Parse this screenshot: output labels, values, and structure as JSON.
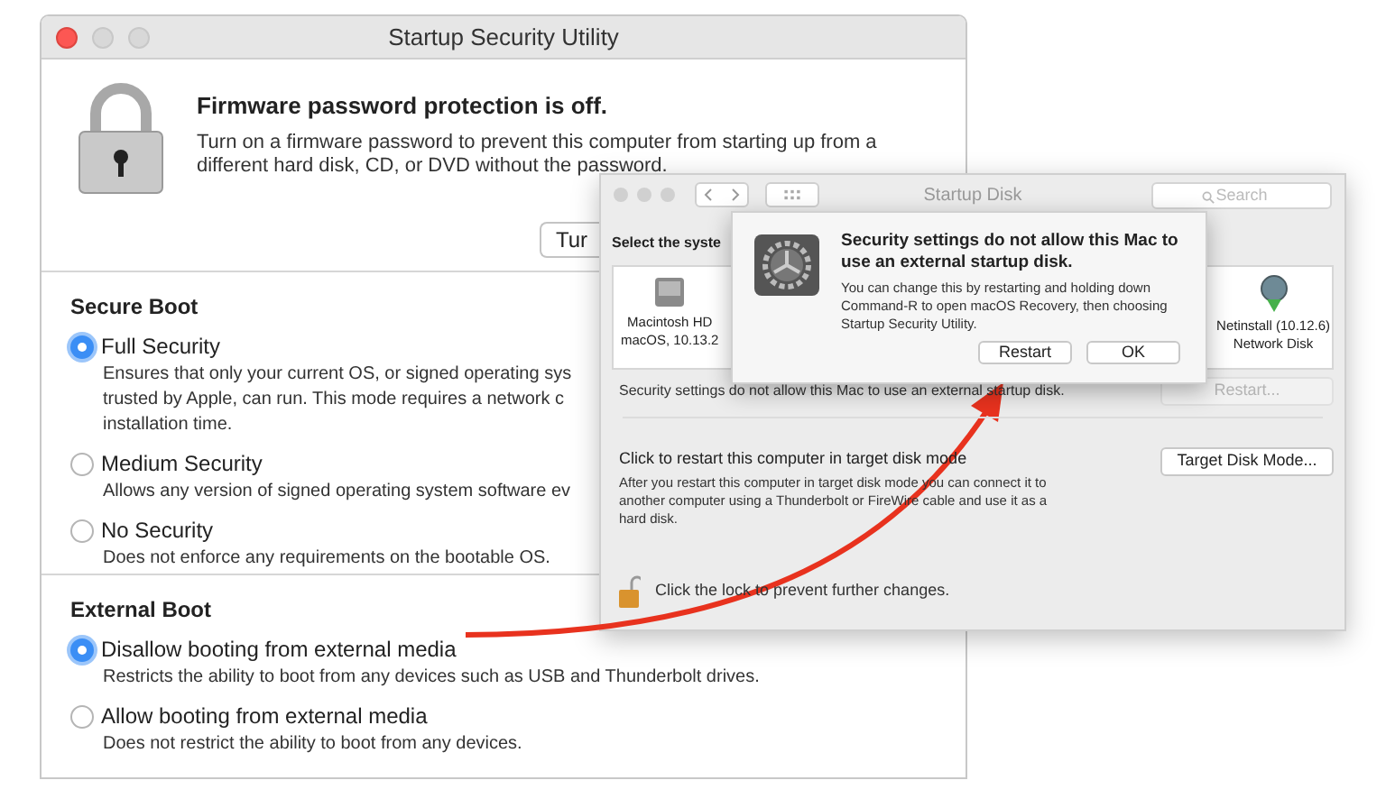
{
  "security_window": {
    "title": "Startup Security Utility",
    "header": {
      "title": "Firmware password protection is off.",
      "description_lines": [
        "Turn on a firmware password to prevent this computer from starting up from a",
        "different hard disk, CD, or DVD without the password."
      ]
    },
    "turn_on_button": "Tur",
    "sections": [
      {
        "title": "Secure Boot",
        "options": [
          {
            "label": "Full Security",
            "selected": true,
            "description_lines": [
              "Ensures that only your current OS, or signed operating sys",
              "trusted by Apple, can run. This mode requires a network c",
              "installation time."
            ]
          },
          {
            "label": "Medium Security",
            "selected": false,
            "description_lines": [
              "Allows any version of signed operating system software ev"
            ]
          },
          {
            "label": "No Security",
            "selected": false,
            "description_lines": [
              "Does not enforce any requirements on the bootable OS."
            ]
          }
        ]
      },
      {
        "title": "External Boot",
        "options": [
          {
            "label": "Disallow booting from external media",
            "selected": true,
            "description_lines": [
              "Restricts the ability to boot from any devices such as USB and Thunderbolt drives."
            ]
          },
          {
            "label": "Allow booting from external media",
            "selected": false,
            "description_lines": [
              "Does not restrict the ability to boot from any devices."
            ]
          }
        ]
      }
    ]
  },
  "startup_disk_window": {
    "title": "Startup Disk",
    "search": {
      "placeholder": "Search"
    },
    "heading": "Select the syste",
    "disks": [
      {
        "kind": "drive",
        "name": "Macintosh HD",
        "detail": "macOS, 10.13.2"
      },
      {
        "kind": "network",
        "name": "Netinstall (10.12.6)",
        "detail": "Network Disk"
      }
    ],
    "status": "Security settings do not allow this Mac to use an external startup disk.",
    "restart_button": {
      "label": "Restart...",
      "disabled": true
    },
    "target_disk": {
      "title": "Click to restart this computer in target disk mode",
      "description_lines": [
        "After you restart this computer in target disk mode you can connect it to",
        "another computer using a Thunderbolt or FireWire cable and use it as a",
        "hard disk."
      ]
    },
    "target_disk_button": {
      "label": "Target Disk Mode...",
      "disabled": false
    },
    "lock_text": "Click the lock to prevent further changes."
  },
  "alert": {
    "title": "Security settings do not allow this Mac to use an external startup disk.",
    "message": "You can change this by restarting and holding down Command-R to open macOS Recovery, then choosing Startup Security Utility.",
    "buttons": [
      {
        "label": "Restart"
      },
      {
        "label": "OK"
      }
    ]
  }
}
